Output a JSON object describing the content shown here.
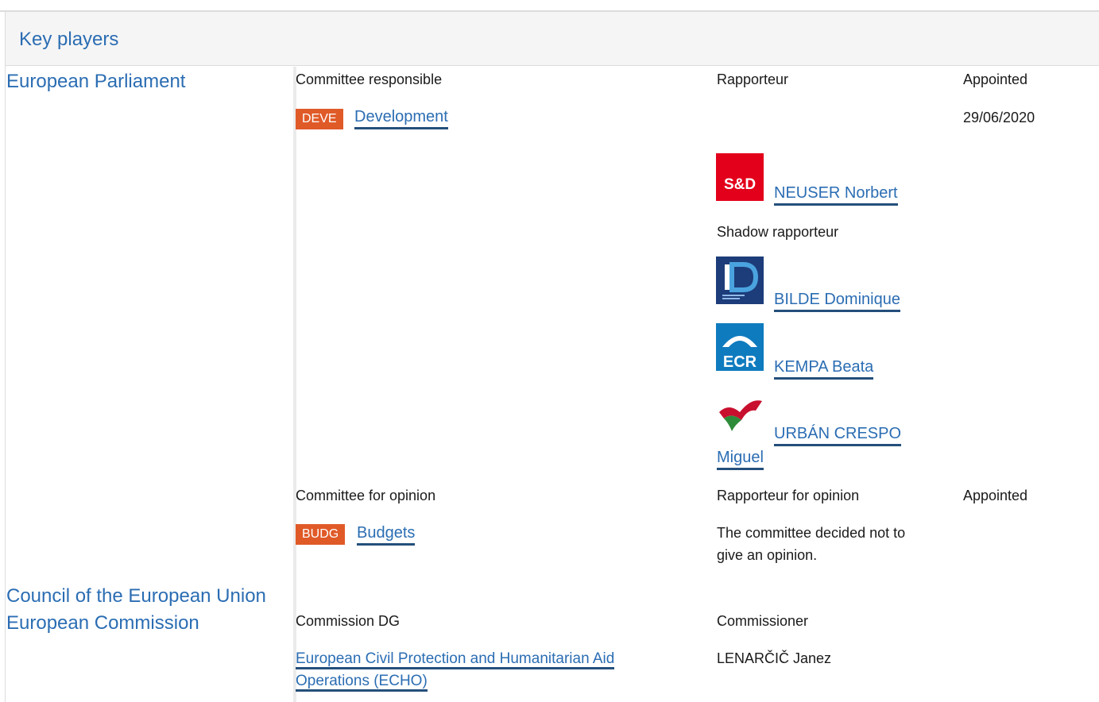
{
  "header": {
    "title": "Key players"
  },
  "institutions": {
    "ep": "European Parliament",
    "council": "Council of the European Union",
    "commission": "European Commission"
  },
  "responsible": {
    "col_committee": "Committee responsible",
    "col_rapporteur": "Rapporteur",
    "col_appointed": "Appointed",
    "committee_code": "DEVE",
    "committee_name": "Development",
    "appointed_date": "29/06/2020",
    "rapporteur": {
      "name": "NEUSER Norbert",
      "group_logo": "S&D"
    },
    "shadow_label": "Shadow rapporteur",
    "shadows": [
      {
        "name": "BILDE Dominique",
        "group_logo": "ID"
      },
      {
        "name": "KEMPA Beata",
        "group_logo": "ECR"
      },
      {
        "name_line1": "URBÁN CRESPO",
        "name_line2": "Miguel",
        "group_logo": "GUE/NGL"
      }
    ]
  },
  "opinion": {
    "col_committee": "Committee for opinion",
    "col_rapporteur": "Rapporteur for opinion",
    "col_appointed": "Appointed",
    "committee_code": "BUDG",
    "committee_name": "Budgets",
    "note_line1": "The committee decided not to",
    "note_line2": "give an opinion."
  },
  "commission": {
    "col_dg": "Commission DG",
    "col_commissioner": "Commissioner",
    "dg_line1": "European Civil Protection and Humanitarian Aid",
    "dg_line2": "Operations (ECHO)",
    "commissioner": "LENARČIČ Janez"
  },
  "colors": {
    "link": "#2b6db3",
    "badge": "#e05a28",
    "underline": "#244f7b"
  }
}
